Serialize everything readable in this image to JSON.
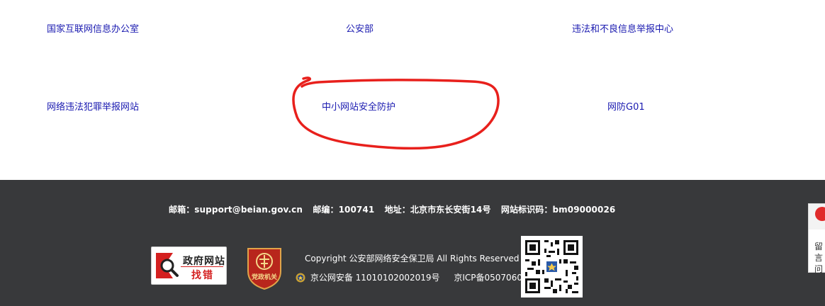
{
  "links": {
    "row1": [
      "国家互联网信息办公室",
      "公安部",
      "违法和不良信息举报中心"
    ],
    "row2": [
      "网络违法犯罪举报网站",
      "中小网站安全防护",
      "网防G01"
    ]
  },
  "footer": {
    "email": "邮箱：support@beian.gov.cn",
    "postcode": "邮编：100741",
    "address": "地址：北京市东长安街14号",
    "site_id": "网站标识码：bm09000026",
    "gov_badge_line1": "政府网站",
    "gov_badge_line2": "找错",
    "party_badge_text": "党政机关",
    "copyright": "Copyright 公安部网络安全保卫局 All Rights Reserved",
    "police_record": "京公网安备 11010102002019号",
    "icp_record": "京ICP备05070602号"
  },
  "side_widget": {
    "text_line1": "留言",
    "text_line2": "问"
  },
  "colors": {
    "link": "#1a1ab0",
    "footer_bg": "#38393b",
    "annotation": "#e8201c"
  }
}
